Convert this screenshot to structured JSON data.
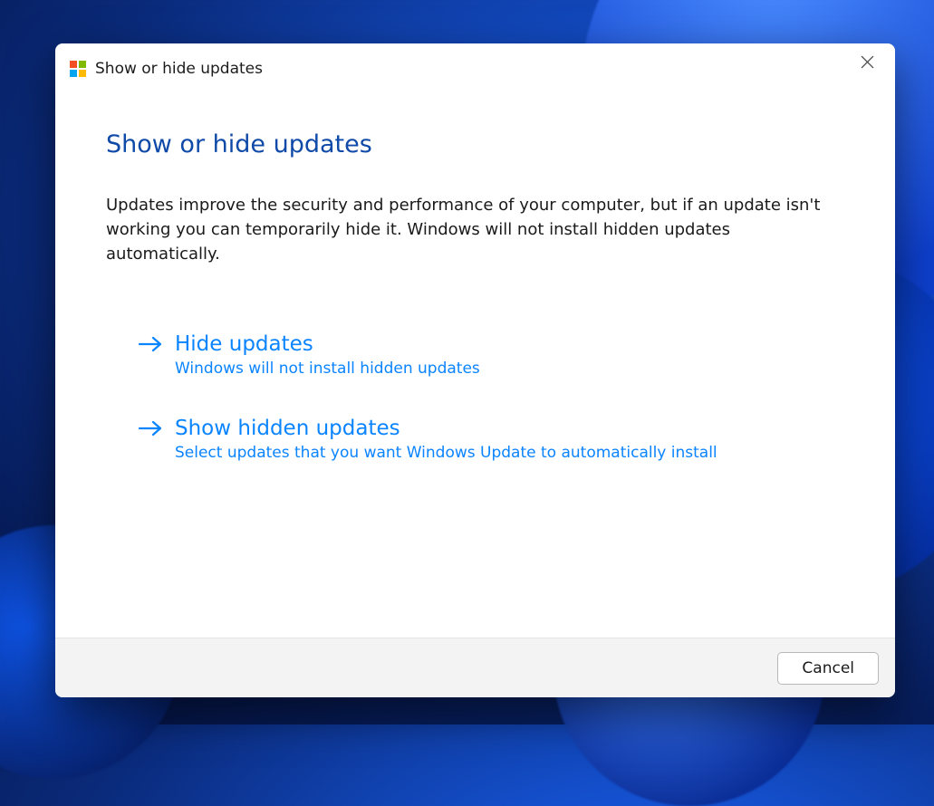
{
  "titlebar": {
    "app_title": "Show or hide updates"
  },
  "page": {
    "heading": "Show or hide updates",
    "description": "Updates improve the security and performance of your computer, but if an update isn't working you can temporarily hide it. Windows will not install hidden updates automatically."
  },
  "options": [
    {
      "title": "Hide updates",
      "subtitle": "Windows will not install hidden updates"
    },
    {
      "title": "Show hidden updates",
      "subtitle": "Select updates that you want Windows Update to automatically install"
    }
  ],
  "footer": {
    "cancel_label": "Cancel"
  },
  "colors": {
    "link_blue": "#0a84ff",
    "heading_blue": "#0f4aa8"
  }
}
